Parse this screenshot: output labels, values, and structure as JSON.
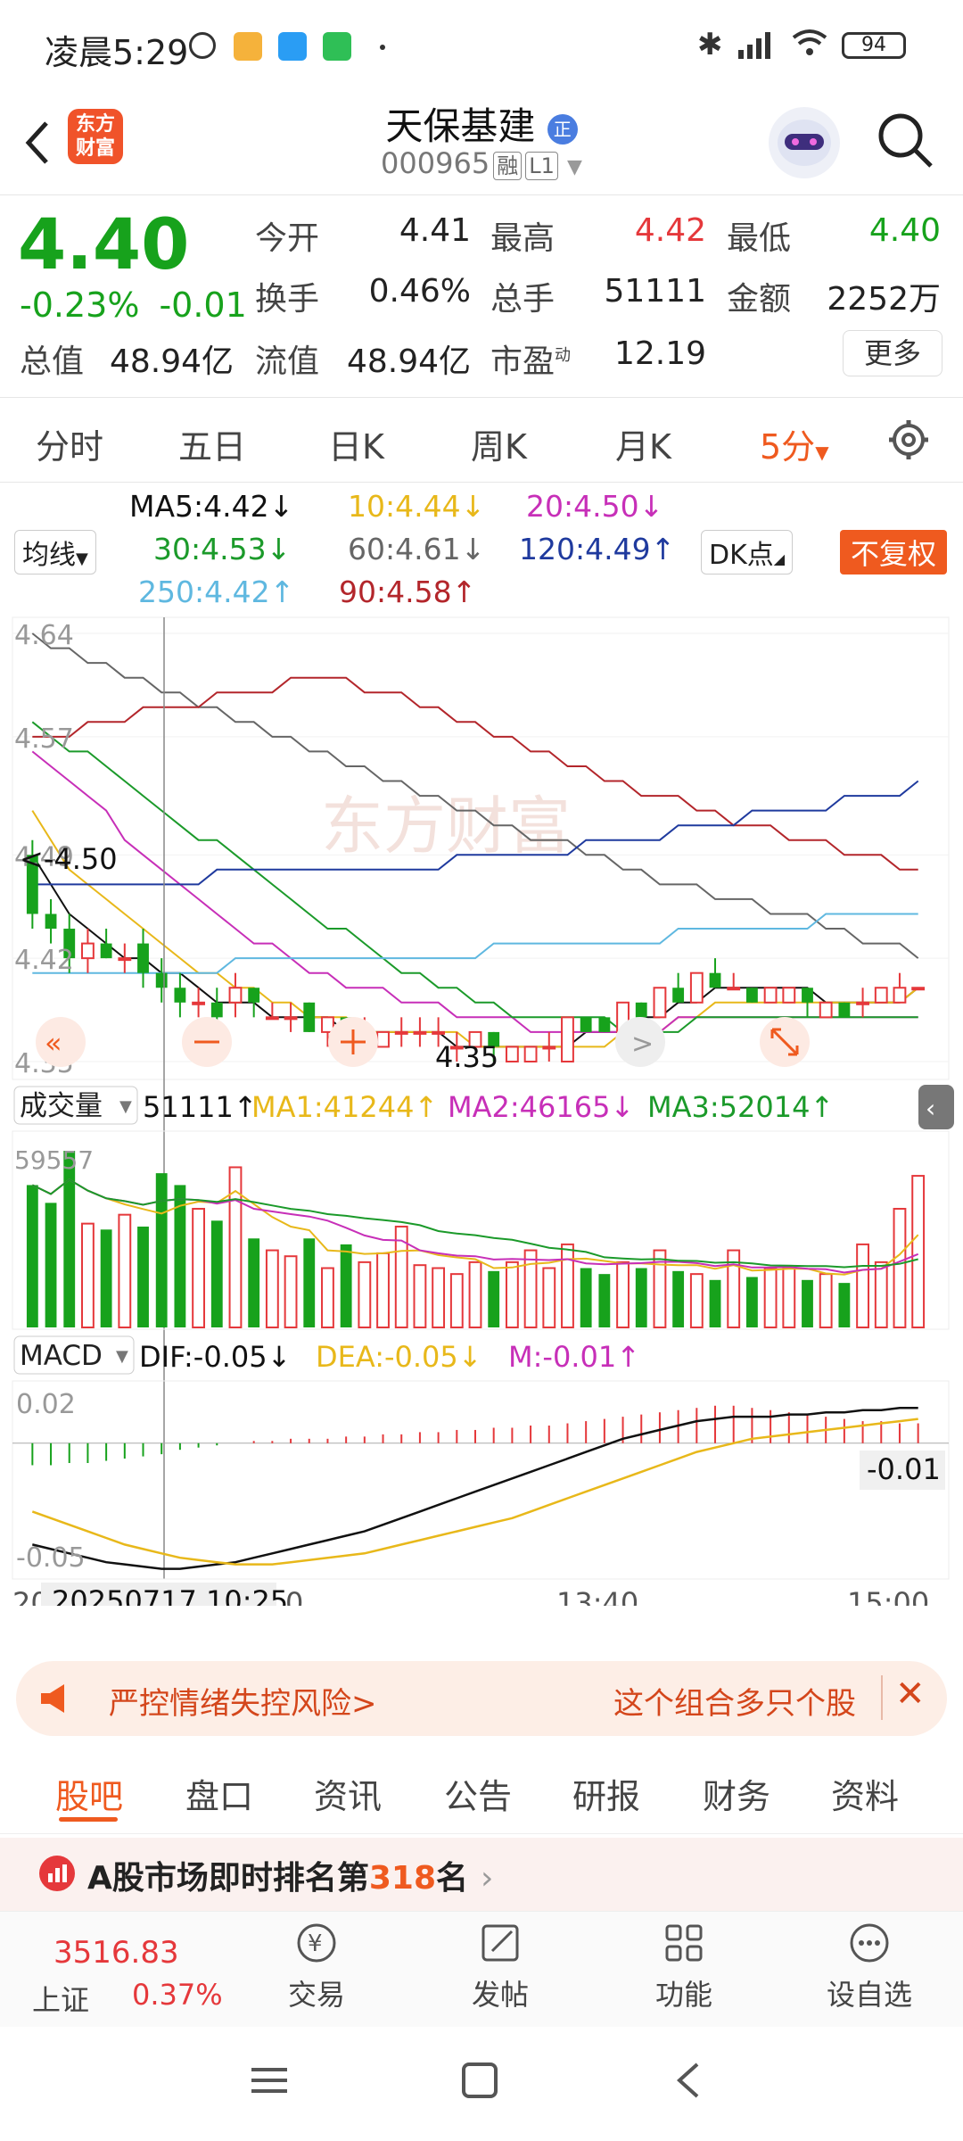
{
  "status_bar": {
    "time": "凌晨5:29",
    "battery": "94"
  },
  "header": {
    "title": "天保基建",
    "code": "000965",
    "badge_rong": "融",
    "badge_level": "L1",
    "logo_text_1": "东方",
    "logo_text_2": "财富",
    "zheng": "正"
  },
  "quote": {
    "price": "4.40",
    "change_pct": "-0.23%",
    "change_abs": "-0.01",
    "open_label": "今开",
    "open": "4.41",
    "high_label": "最高",
    "high": "4.42",
    "low_label": "最低",
    "low": "4.40",
    "turnover_label": "换手",
    "turnover": "0.46%",
    "volume_label": "总手",
    "volume": "51111",
    "amount_label": "金额",
    "amount": "2252万",
    "mktcap_label": "总值",
    "mktcap": "48.94亿",
    "float_label": "流值",
    "float": "48.94亿",
    "pe_label": "市盈",
    "pe_sup": "动",
    "pe": "12.19",
    "more": "更多"
  },
  "period_tabs": [
    "分时",
    "五日",
    "日K",
    "周K",
    "月K",
    "5分"
  ],
  "indicators": {
    "ma_button": "均线",
    "ma5": "MA5:4.42↓",
    "ma10": "10:4.44↓",
    "ma20": "20:4.50↓",
    "ma30": "30:4.53↓",
    "ma60": "60:4.61↓",
    "ma120": "120:4.49↑",
    "ma250": "250:4.42↑",
    "ma90": "90:4.58↑",
    "dk_button": "DK点",
    "fq_button": "不复权"
  },
  "colors": {
    "up": "#e5383b",
    "down": "#17a21c",
    "accent": "#ef5a1f",
    "ma5": "#111111",
    "ma10": "#e8b81a",
    "ma20": "#c72fb8",
    "ma30": "#1b9a2a",
    "ma60": "#666666",
    "ma120": "#1f3a9e",
    "ma250": "#5fb8e0",
    "ma90": "#b3262b"
  },
  "chart": {
    "y_labels": [
      "4.64",
      "4.57",
      "4.49",
      "4.42",
      "4.35"
    ],
    "pointer_label": "<-4.50",
    "low_label": "4.35",
    "watermark": "东方财富",
    "vol_button": "成交量",
    "vol_total": "51111↑",
    "vol_ma1": "MA1:41244↑",
    "vol_ma2": "MA2:46165↓",
    "vol_ma3": "MA3:52014↑",
    "vol_max": "59557",
    "macd_button": "MACD",
    "dif": "DIF:-0.05↓",
    "dea": "DEA:-0.05↓",
    "m": "M:-0.01↑",
    "macd_top": "0.02",
    "macd_bottom": "-0.05",
    "macd_readout": "-0.01",
    "time_axis": [
      "13:40",
      "15:00"
    ],
    "cursor_time": "20250717 10:25",
    "axis_prefix": "20",
    "axis_partial": "0"
  },
  "chart_data": {
    "type": "candlestick",
    "ylim": [
      4.35,
      4.64
    ],
    "candles": [
      [
        4.49,
        4.45,
        4.5,
        4.44
      ],
      [
        4.45,
        4.44,
        4.46,
        4.43
      ],
      [
        4.44,
        4.42,
        4.45,
        4.41
      ],
      [
        4.42,
        4.43,
        4.44,
        4.41
      ],
      [
        4.43,
        4.42,
        4.44,
        4.42
      ],
      [
        4.42,
        4.42,
        4.43,
        4.41
      ],
      [
        4.43,
        4.41,
        4.44,
        4.4
      ],
      [
        4.41,
        4.4,
        4.42,
        4.39
      ],
      [
        4.4,
        4.39,
        4.41,
        4.38
      ],
      [
        4.39,
        4.39,
        4.4,
        4.38
      ],
      [
        4.39,
        4.38,
        4.4,
        4.37
      ],
      [
        4.39,
        4.4,
        4.41,
        4.38
      ],
      [
        4.4,
        4.39,
        4.4,
        4.38
      ],
      [
        4.38,
        4.38,
        4.39,
        4.38
      ],
      [
        4.38,
        4.38,
        4.39,
        4.37
      ],
      [
        4.39,
        4.37,
        4.39,
        4.37
      ],
      [
        4.37,
        4.38,
        4.38,
        4.36
      ],
      [
        4.38,
        4.37,
        4.38,
        4.37
      ],
      [
        4.37,
        4.37,
        4.38,
        4.36
      ],
      [
        4.36,
        4.37,
        4.37,
        4.36
      ],
      [
        4.37,
        4.37,
        4.38,
        4.36
      ],
      [
        4.37,
        4.37,
        4.38,
        4.36
      ],
      [
        4.37,
        4.37,
        4.38,
        4.36
      ],
      [
        4.36,
        4.36,
        4.37,
        4.35
      ],
      [
        4.36,
        4.37,
        4.37,
        4.36
      ],
      [
        4.37,
        4.36,
        4.37,
        4.35
      ],
      [
        4.35,
        4.36,
        4.36,
        4.35
      ],
      [
        4.35,
        4.36,
        4.36,
        4.35
      ],
      [
        4.36,
        4.36,
        4.37,
        4.35
      ],
      [
        4.35,
        4.38,
        4.38,
        4.35
      ],
      [
        4.38,
        4.37,
        4.38,
        4.37
      ],
      [
        4.38,
        4.37,
        4.38,
        4.37
      ],
      [
        4.37,
        4.39,
        4.39,
        4.37
      ],
      [
        4.39,
        4.38,
        4.39,
        4.38
      ],
      [
        4.38,
        4.4,
        4.4,
        4.38
      ],
      [
        4.4,
        4.39,
        4.41,
        4.39
      ],
      [
        4.39,
        4.41,
        4.41,
        4.39
      ],
      [
        4.41,
        4.4,
        4.42,
        4.4
      ],
      [
        4.4,
        4.4,
        4.41,
        4.4
      ],
      [
        4.4,
        4.39,
        4.4,
        4.39
      ],
      [
        4.39,
        4.4,
        4.4,
        4.39
      ],
      [
        4.39,
        4.4,
        4.4,
        4.39
      ],
      [
        4.4,
        4.39,
        4.4,
        4.38
      ],
      [
        4.38,
        4.39,
        4.39,
        4.38
      ],
      [
        4.39,
        4.38,
        4.39,
        4.38
      ],
      [
        4.39,
        4.39,
        4.4,
        4.38
      ],
      [
        4.39,
        4.4,
        4.4,
        4.39
      ],
      [
        4.39,
        4.4,
        4.41,
        4.39
      ],
      [
        4.4,
        4.4,
        4.4,
        4.4
      ]
    ],
    "ma": {
      "ma5": [
        4.49,
        4.47,
        4.45,
        4.44,
        4.43,
        4.42,
        4.42,
        4.41,
        4.41,
        4.4,
        4.39,
        4.39,
        4.39,
        4.38,
        4.38,
        4.38,
        4.38,
        4.37,
        4.37,
        4.37,
        4.37,
        4.37,
        4.37,
        4.36,
        4.36,
        4.36,
        4.36,
        4.36,
        4.36,
        4.36,
        4.37,
        4.37,
        4.37,
        4.38,
        4.38,
        4.39,
        4.39,
        4.4,
        4.4,
        4.4,
        4.4,
        4.4,
        4.4,
        4.39,
        4.39,
        4.39,
        4.39,
        4.39,
        4.4
      ],
      "ma10": [
        4.52,
        4.5,
        4.48,
        4.47,
        4.46,
        4.45,
        4.44,
        4.43,
        4.42,
        4.41,
        4.41,
        4.4,
        4.4,
        4.39,
        4.39,
        4.38,
        4.38,
        4.38,
        4.37,
        4.37,
        4.37,
        4.37,
        4.37,
        4.37,
        4.36,
        4.36,
        4.36,
        4.36,
        4.36,
        4.36,
        4.36,
        4.36,
        4.37,
        4.37,
        4.37,
        4.38,
        4.38,
        4.39,
        4.39,
        4.39,
        4.39,
        4.39,
        4.39,
        4.39,
        4.39,
        4.39,
        4.39,
        4.39,
        4.4
      ],
      "ma20": [
        4.56,
        4.55,
        4.54,
        4.53,
        4.52,
        4.5,
        4.49,
        4.48,
        4.47,
        4.46,
        4.45,
        4.44,
        4.43,
        4.43,
        4.42,
        4.41,
        4.41,
        4.4,
        4.4,
        4.4,
        4.39,
        4.39,
        4.39,
        4.38,
        4.38,
        4.38,
        4.38,
        4.37,
        4.37,
        4.37,
        4.37,
        4.37,
        4.37,
        4.37,
        4.37,
        4.38,
        4.38,
        4.38,
        4.38,
        4.38,
        4.38,
        4.38,
        4.38,
        4.38,
        4.38,
        4.38,
        4.38,
        4.38,
        4.38
      ],
      "ma30": [
        4.58,
        4.57,
        4.56,
        4.56,
        4.55,
        4.54,
        4.53,
        4.52,
        4.51,
        4.5,
        4.5,
        4.49,
        4.48,
        4.47,
        4.46,
        4.45,
        4.44,
        4.44,
        4.43,
        4.42,
        4.41,
        4.41,
        4.4,
        4.4,
        4.39,
        4.39,
        4.38,
        4.38,
        4.38,
        4.38,
        4.38,
        4.38,
        4.37,
        4.37,
        4.37,
        4.37,
        4.38,
        4.38,
        4.38,
        4.38,
        4.38,
        4.38,
        4.38,
        4.38,
        4.38,
        4.38,
        4.38,
        4.38,
        4.38
      ],
      "ma60": [
        4.64,
        4.63,
        4.63,
        4.62,
        4.62,
        4.61,
        4.61,
        4.6,
        4.6,
        4.59,
        4.59,
        4.58,
        4.58,
        4.57,
        4.57,
        4.56,
        4.56,
        4.55,
        4.55,
        4.54,
        4.54,
        4.53,
        4.53,
        4.52,
        4.52,
        4.51,
        4.51,
        4.5,
        4.5,
        4.5,
        4.49,
        4.49,
        4.48,
        4.48,
        4.47,
        4.47,
        4.47,
        4.46,
        4.46,
        4.46,
        4.45,
        4.45,
        4.45,
        4.44,
        4.44,
        4.43,
        4.43,
        4.43,
        4.42
      ],
      "ma90": [
        4.57,
        4.57,
        4.57,
        4.58,
        4.58,
        4.58,
        4.59,
        4.59,
        4.59,
        4.59,
        4.6,
        4.6,
        4.6,
        4.6,
        4.61,
        4.61,
        4.61,
        4.61,
        4.6,
        4.6,
        4.6,
        4.59,
        4.59,
        4.58,
        4.58,
        4.57,
        4.57,
        4.56,
        4.56,
        4.55,
        4.55,
        4.54,
        4.54,
        4.53,
        4.53,
        4.53,
        4.52,
        4.52,
        4.51,
        4.51,
        4.51,
        4.5,
        4.5,
        4.5,
        4.49,
        4.49,
        4.49,
        4.48,
        4.48
      ],
      "ma120": [
        4.47,
        4.47,
        4.47,
        4.47,
        4.47,
        4.47,
        4.47,
        4.47,
        4.47,
        4.47,
        4.48,
        4.48,
        4.48,
        4.48,
        4.48,
        4.48,
        4.48,
        4.48,
        4.48,
        4.48,
        4.48,
        4.48,
        4.48,
        4.49,
        4.49,
        4.49,
        4.49,
        4.49,
        4.49,
        4.49,
        4.5,
        4.5,
        4.5,
        4.5,
        4.5,
        4.51,
        4.51,
        4.51,
        4.51,
        4.52,
        4.52,
        4.52,
        4.52,
        4.52,
        4.53,
        4.53,
        4.53,
        4.53,
        4.54
      ],
      "ma250": [
        4.41,
        4.41,
        4.41,
        4.41,
        4.41,
        4.41,
        4.41,
        4.41,
        4.41,
        4.41,
        4.41,
        4.42,
        4.42,
        4.42,
        4.42,
        4.42,
        4.42,
        4.42,
        4.42,
        4.42,
        4.42,
        4.42,
        4.42,
        4.42,
        4.42,
        4.43,
        4.43,
        4.43,
        4.43,
        4.43,
        4.43,
        4.43,
        4.43,
        4.43,
        4.43,
        4.44,
        4.44,
        4.44,
        4.44,
        4.44,
        4.44,
        4.44,
        4.44,
        4.45,
        4.45,
        4.45,
        4.45,
        4.45,
        4.45
      ]
    },
    "volume": [
      48000,
      42000,
      59557,
      35000,
      33000,
      38000,
      34000,
      52000,
      48000,
      40000,
      36000,
      54000,
      30000,
      26000,
      24000,
      30000,
      20000,
      28000,
      22000,
      25000,
      34000,
      21000,
      20000,
      18000,
      22000,
      19000,
      22000,
      26000,
      20000,
      28000,
      20000,
      18000,
      22000,
      20000,
      26000,
      19000,
      18000,
      16000,
      26000,
      17000,
      20000,
      20000,
      16000,
      18000,
      15000,
      28000,
      22000,
      40000,
      51111
    ],
    "macd": [
      -0.01,
      -0.01,
      -0.009,
      -0.009,
      -0.008,
      -0.007,
      -0.006,
      -0.005,
      -0.003,
      -0.002,
      -0.001,
      0.0,
      0.001,
      0.001,
      0.002,
      0.002,
      0.002,
      0.003,
      0.003,
      0.004,
      0.004,
      0.005,
      0.005,
      0.006,
      0.006,
      0.007,
      0.007,
      0.008,
      0.008,
      0.009,
      0.01,
      0.011,
      0.012,
      0.013,
      0.014,
      0.015,
      0.016,
      0.017,
      0.017,
      0.016,
      0.015,
      0.014,
      0.013,
      0.012,
      0.011,
      0.01,
      0.01,
      0.009,
      0.009
    ],
    "dif": [
      -0.046,
      -0.048,
      -0.05,
      -0.052,
      -0.054,
      -0.055,
      -0.056,
      -0.057,
      -0.057,
      -0.056,
      -0.055,
      -0.054,
      -0.052,
      -0.05,
      -0.048,
      -0.046,
      -0.044,
      -0.042,
      -0.04,
      -0.037,
      -0.034,
      -0.031,
      -0.028,
      -0.025,
      -0.022,
      -0.019,
      -0.016,
      -0.013,
      -0.01,
      -0.007,
      -0.004,
      -0.001,
      0.002,
      0.004,
      0.006,
      0.008,
      0.01,
      0.011,
      0.012,
      0.012,
      0.012,
      0.013,
      0.013,
      0.014,
      0.014,
      0.015,
      0.015,
      0.016,
      0.016
    ],
    "dea": [
      -0.031,
      -0.034,
      -0.037,
      -0.04,
      -0.043,
      -0.046,
      -0.048,
      -0.05,
      -0.052,
      -0.053,
      -0.054,
      -0.055,
      -0.055,
      -0.055,
      -0.054,
      -0.053,
      -0.052,
      -0.051,
      -0.05,
      -0.048,
      -0.046,
      -0.044,
      -0.042,
      -0.04,
      -0.038,
      -0.036,
      -0.034,
      -0.031,
      -0.028,
      -0.025,
      -0.022,
      -0.019,
      -0.016,
      -0.013,
      -0.01,
      -0.007,
      -0.004,
      -0.002,
      0.0,
      0.002,
      0.003,
      0.004,
      0.005,
      0.006,
      0.007,
      0.008,
      0.009,
      0.01,
      0.011
    ]
  },
  "banner": {
    "left": "严控情绪失控风险>",
    "right": "这个组合多只个股"
  },
  "bottom_tabs": [
    "股吧",
    "盘口",
    "资讯",
    "公告",
    "研报",
    "财务",
    "资料"
  ],
  "rank": {
    "prefix": "A股市场即时排名第",
    "num": "318",
    "suffix": "名"
  },
  "footer": {
    "index_value": "3516.83",
    "index_name": "上证",
    "index_pct": "0.37%",
    "items": [
      "交易",
      "发帖",
      "功能",
      "设自选"
    ]
  }
}
